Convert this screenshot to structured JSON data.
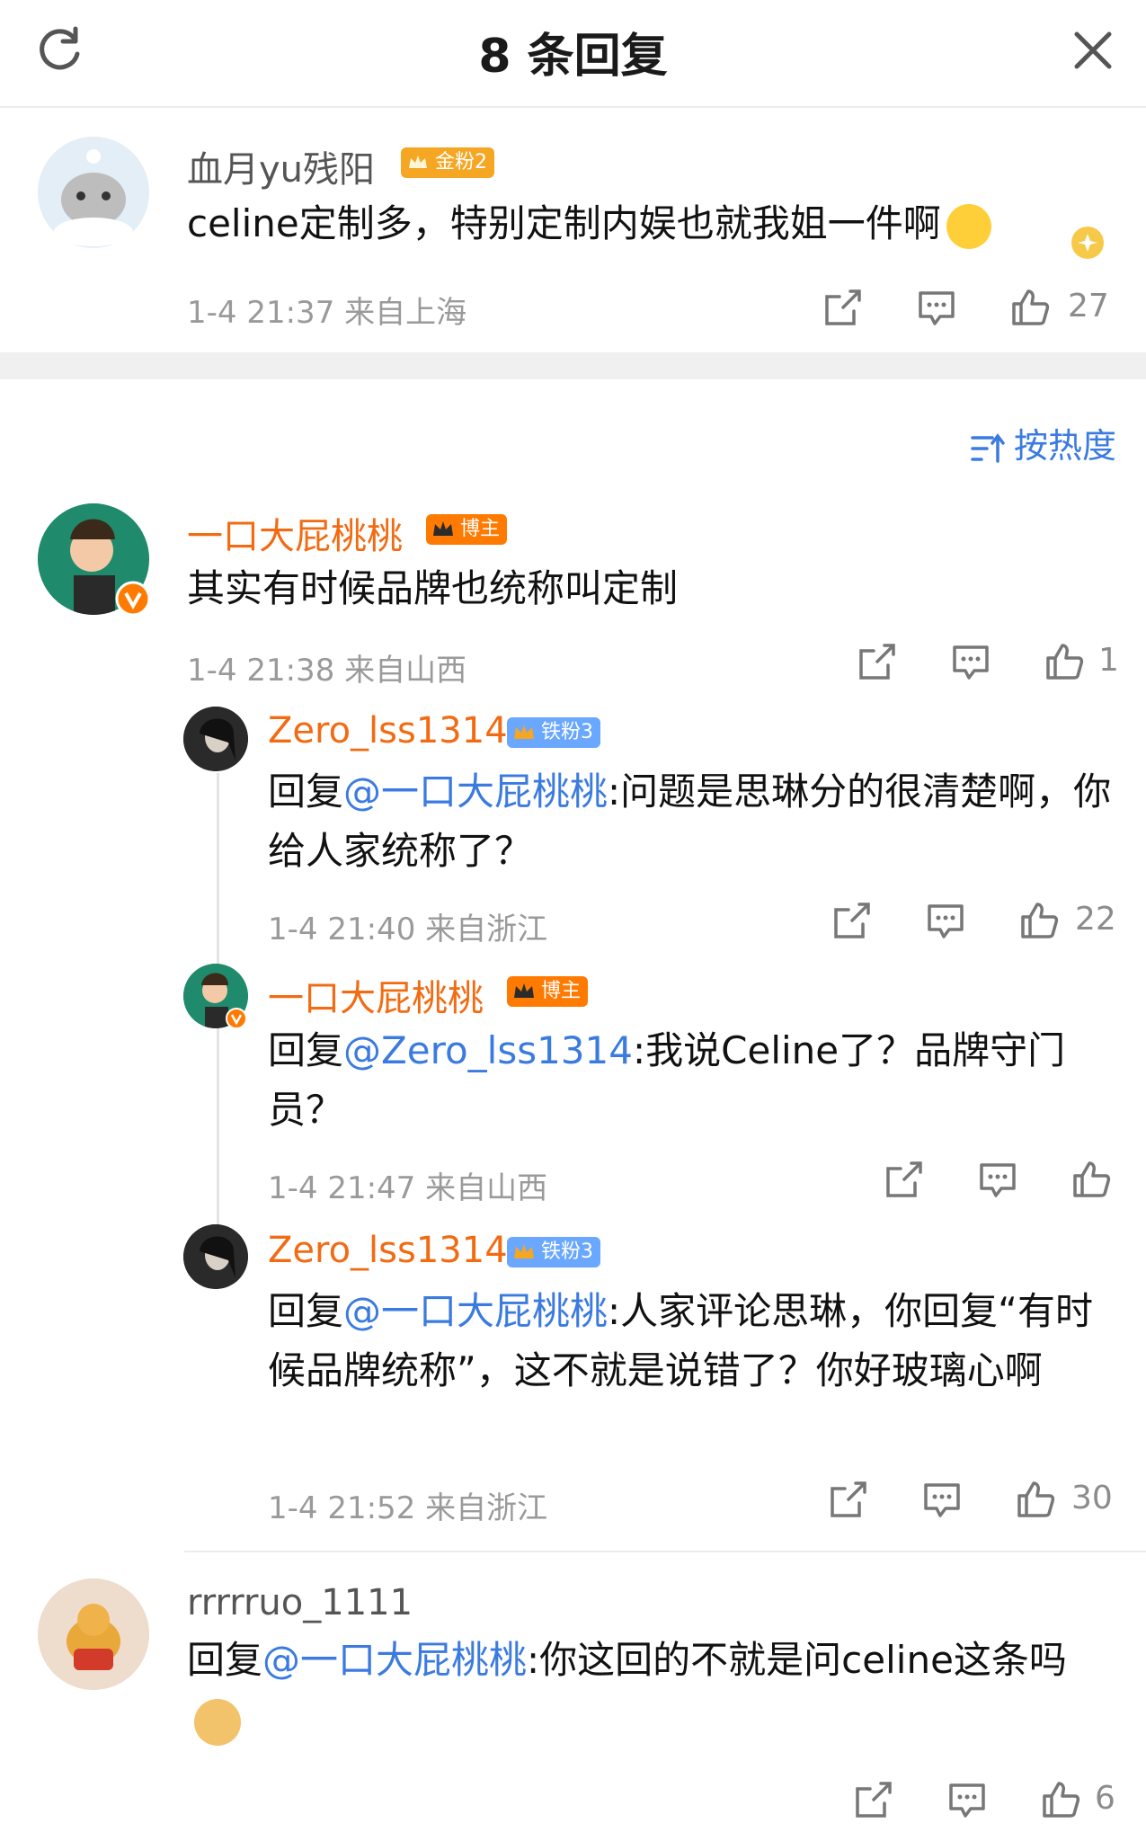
{
  "header": {
    "title": "8 条回复"
  },
  "root": {
    "user": "血月yu残阳",
    "badge": "金粉2",
    "text": "celine定制多，特别定制内娱也就我姐一件啊",
    "time": "1-4 21:37",
    "location": "来自上海",
    "likes": "27"
  },
  "sort": {
    "label": "按热度"
  },
  "comments": [
    {
      "user": "一口大屁桃桃",
      "badge": "博主",
      "text": "其实有时候品牌也统称叫定制",
      "time": "1-4 21:38",
      "location": "来自山西",
      "likes": "1"
    },
    {
      "user": "Zero_lss1314",
      "badge": "铁粉3",
      "reply_prefix": "回复",
      "mention": "@一口大屁桃桃",
      "text": ":问题是思琳分的很清楚啊，你给人家统称了？",
      "time": "1-4 21:40",
      "location": "来自浙江",
      "likes": "22"
    },
    {
      "user": "一口大屁桃桃",
      "badge": "博主",
      "reply_prefix": "回复",
      "mention": "@Zero_lss1314",
      "text": ":我说Celine了？品牌守门员？",
      "time": "1-4 21:47",
      "location": "来自山西",
      "likes": ""
    },
    {
      "user": "Zero_lss1314",
      "badge": "铁粉3",
      "reply_prefix": "回复",
      "mention": "@一口大屁桃桃",
      "text": ":人家评论思琳，你回复“有时候品牌统称”，这不就是说错了？你好玻璃心啊",
      "time": "1-4 21:52",
      "location": "来自浙江",
      "likes": "30"
    },
    {
      "user": "rrrrruo_1111",
      "reply_prefix": "回复",
      "mention": "@一口大屁桃桃",
      "text": ":你这回的不就是问celine这条吗",
      "likes": "6"
    }
  ]
}
